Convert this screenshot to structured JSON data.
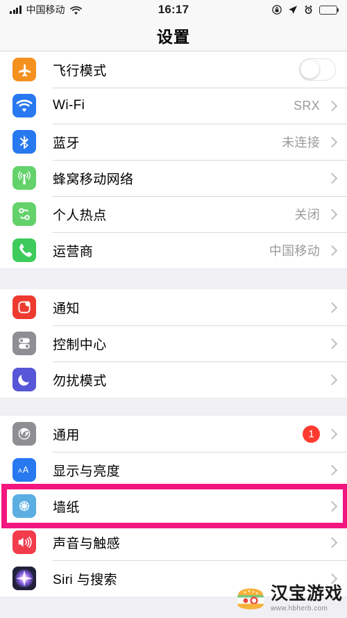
{
  "status_bar": {
    "carrier": "中国移动",
    "time": "16:17",
    "signal_icon": "signal-bars-icon",
    "wifi_icon": "wifi-icon",
    "rotation_lock_icon": "rotation-lock-icon",
    "location_icon": "location-arrow-icon",
    "alarm_icon": "alarm-clock-icon",
    "battery_icon": "battery-icon"
  },
  "navbar": {
    "title": "设置"
  },
  "sections": [
    {
      "id": "connectivity",
      "rows": [
        {
          "label": "飞行模式",
          "icon": "airplane-icon",
          "icon_color": "#F4911E",
          "control": "toggle",
          "toggle_on": false
        },
        {
          "label": "Wi-Fi",
          "icon": "wifi-icon",
          "icon_color": "#2878F0",
          "value": "SRX",
          "control": "chevron"
        },
        {
          "label": "蓝牙",
          "icon": "bluetooth-icon",
          "icon_color": "#2878F0",
          "value": "未连接",
          "control": "chevron"
        },
        {
          "label": "蜂窝移动网络",
          "icon": "cellular-icon",
          "icon_color": "#63D26A",
          "value": "",
          "control": "chevron"
        },
        {
          "label": "个人热点",
          "icon": "hotspot-icon",
          "icon_color": "#63D26A",
          "value": "关闭",
          "control": "chevron"
        },
        {
          "label": "运营商",
          "icon": "phone-icon",
          "icon_color": "#3ECB5B",
          "value": "中国移动",
          "control": "chevron"
        }
      ]
    },
    {
      "id": "notifications",
      "rows": [
        {
          "label": "通知",
          "icon": "notifications-icon",
          "icon_color": "#EE3B30",
          "value": "",
          "control": "chevron"
        },
        {
          "label": "控制中心",
          "icon": "control-center-icon",
          "icon_color": "#8E8E93",
          "value": "",
          "control": "chevron"
        },
        {
          "label": "勿扰模式",
          "icon": "moon-icon",
          "icon_color": "#5656D6",
          "value": "",
          "control": "chevron"
        }
      ]
    },
    {
      "id": "system",
      "rows": [
        {
          "label": "通用",
          "icon": "gear-icon",
          "icon_color": "#8E8E93",
          "badge": "1",
          "control": "chevron"
        },
        {
          "label": "显示与亮度",
          "icon": "display-brightness-icon",
          "icon_color": "#2878F0",
          "value": "",
          "control": "chevron",
          "highlighted": true
        },
        {
          "label": "墙纸",
          "icon": "wallpaper-icon",
          "icon_color": "#5BAEE2",
          "value": "",
          "control": "chevron"
        },
        {
          "label": "声音与触感",
          "icon": "sounds-haptics-icon",
          "icon_color": "#F23C4C",
          "value": "",
          "control": "chevron"
        },
        {
          "label": "Siri 与搜索",
          "icon": "siri-icon",
          "icon_color": "#2B2B3C",
          "value": "",
          "control": "chevron"
        }
      ]
    }
  ],
  "highlight": {
    "color": "#F4167F",
    "target": "显示与亮度"
  },
  "watermark": {
    "title": "汉宝游戏",
    "url": "www.hbherb.com",
    "icon": "burger-logo-icon"
  }
}
